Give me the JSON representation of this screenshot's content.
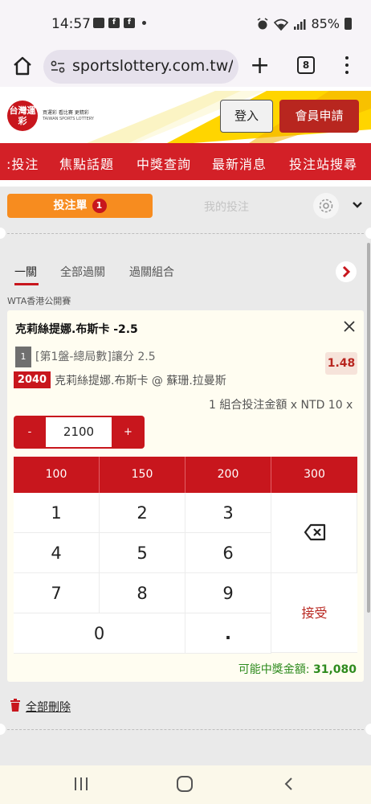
{
  "status_bar": {
    "time": "14:57",
    "battery": "85%"
  },
  "browser": {
    "url": "sportslottery.com.tw/s",
    "tab_count": "8"
  },
  "header": {
    "logo_text": "台灣運彩",
    "logo_sub1": "買運彩 看比賽 更精彩",
    "logo_sub2": "TAIWAN SPORTS LOTTERY",
    "login_label": "登入",
    "register_label": "會員申請"
  },
  "nav": {
    "items": [
      ":投注",
      "焦點話題",
      "中獎查詢",
      "最新消息",
      "投注站搜尋"
    ]
  },
  "panel": {
    "betslip_tab": "投注單",
    "betslip_count": "1",
    "mybets_tab": "我的投注",
    "subtabs": [
      "一關",
      "全部過關",
      "過關組合"
    ],
    "league": "WTA香港公開賽",
    "selection": {
      "title": "克莉絲提娜.布斯卡 -2.5",
      "leg_number": "1",
      "market": "[第1盤-總局數]讓分 2.5",
      "odds": "1.48",
      "game_no": "2040",
      "matchup": "克莉絲提娜.布斯卡 @ 蘇珊.拉曼斯"
    },
    "combo_info": "1 組合投注金額 x NTD 10 x",
    "stepper": {
      "minus": "-",
      "value": "2100",
      "plus": "+"
    },
    "quick_amounts": [
      "100",
      "150",
      "200",
      "300"
    ],
    "keys": [
      "1",
      "2",
      "3",
      "4",
      "5",
      "6",
      "7",
      "8",
      "9",
      "0",
      "."
    ],
    "accept_label": "接受",
    "payout_label": "可能中獎金額:",
    "payout_value": "31,080",
    "delete_all": "全部刪除"
  }
}
